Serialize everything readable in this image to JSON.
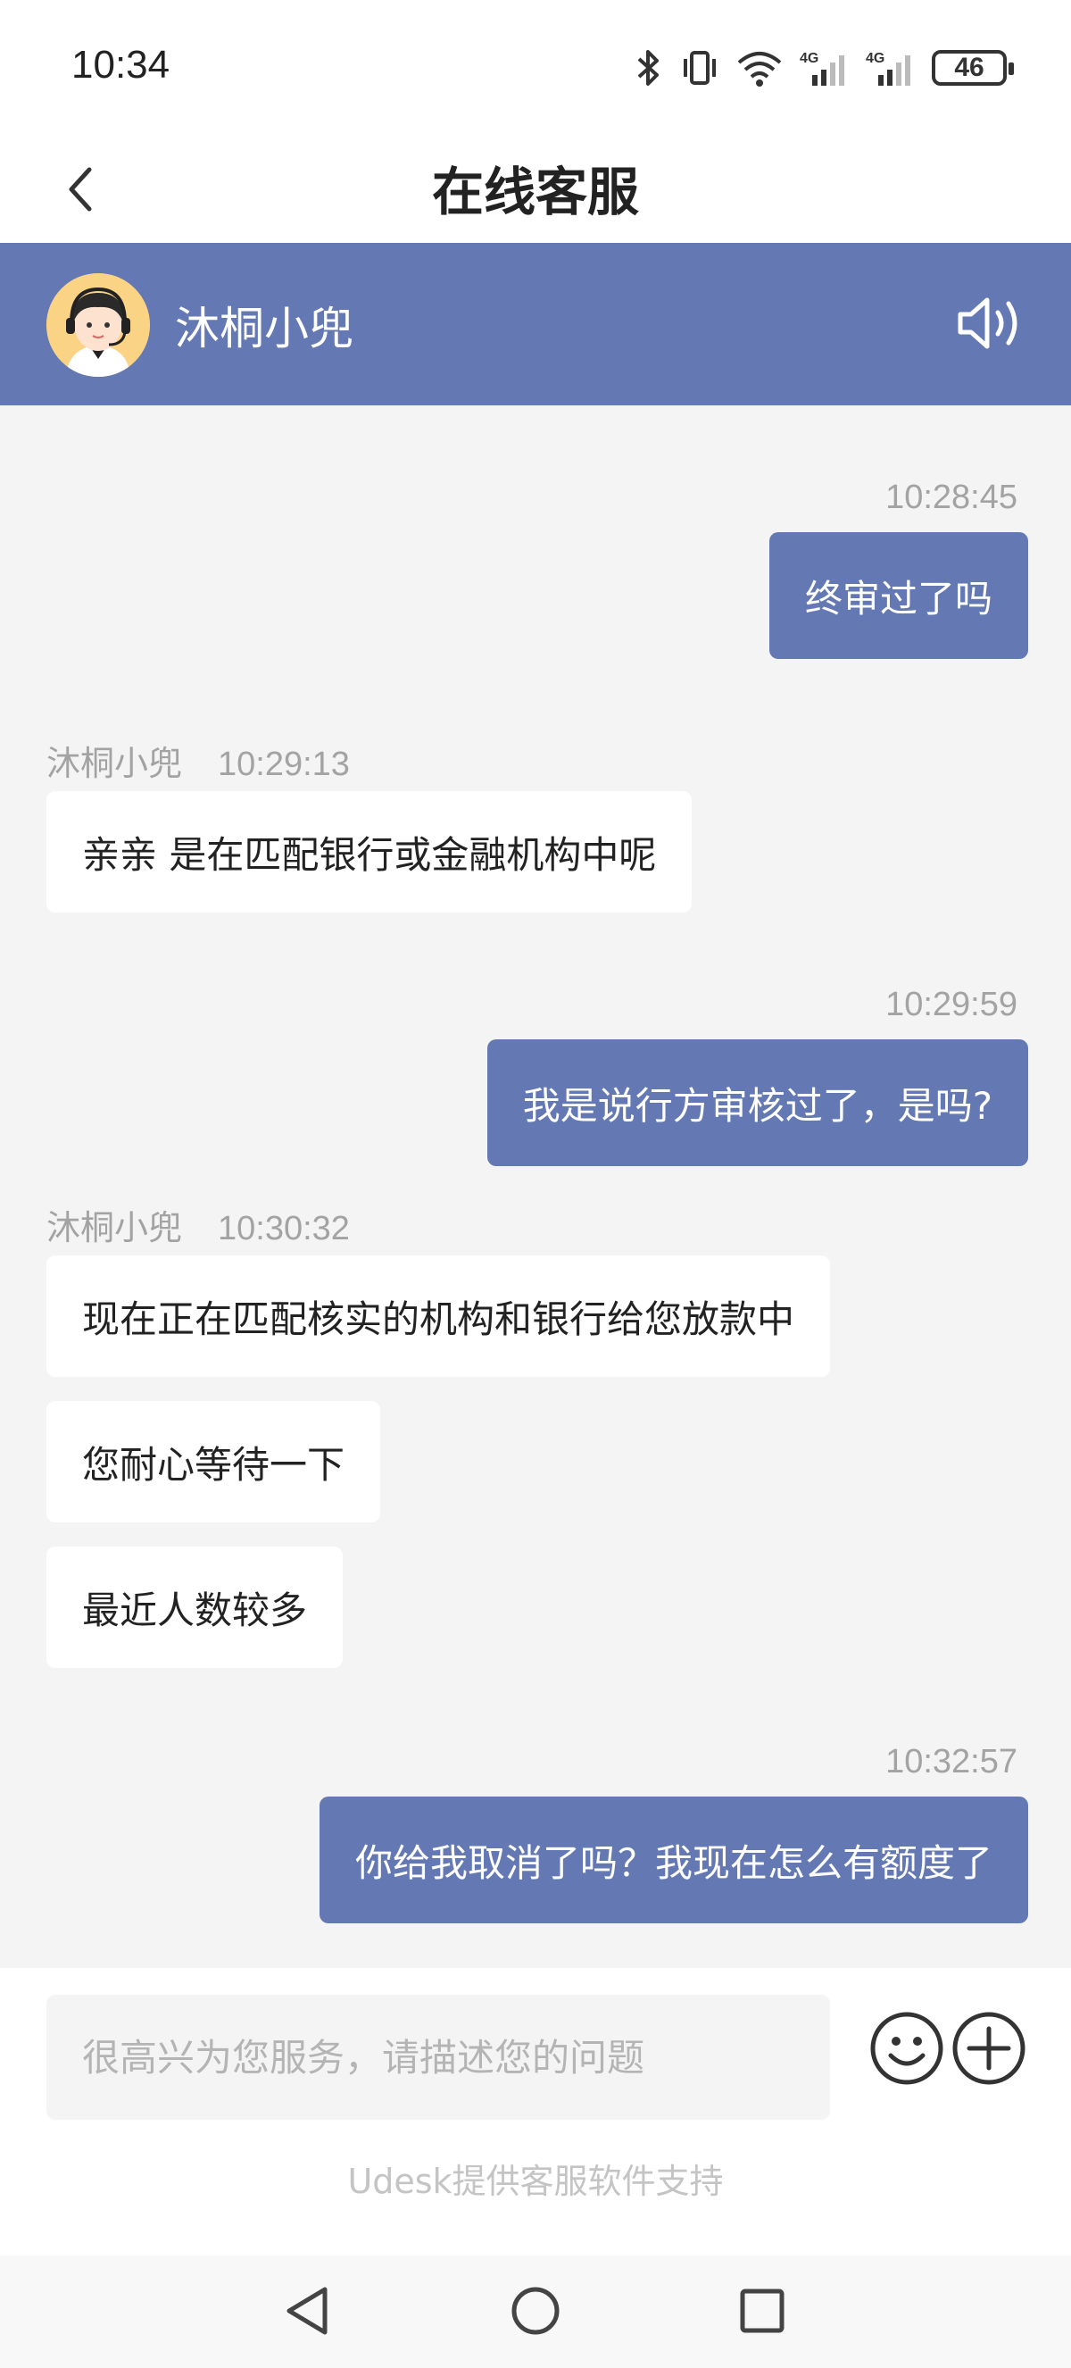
{
  "status_bar": {
    "time": "10:34",
    "battery": "46",
    "icons": [
      "bluetooth-icon",
      "vibrate-icon",
      "wifi-icon",
      "signal-4g-icon",
      "signal-4g-icon",
      "battery-icon"
    ],
    "network_labels": [
      "4G",
      "4G"
    ]
  },
  "header": {
    "title": "在线客服"
  },
  "agent": {
    "name": "沐桐小兜",
    "header_color": "#6479b3"
  },
  "messages": [
    {
      "side": "out",
      "time": "10:28:45",
      "text": "终审过了吗"
    },
    {
      "side": "in",
      "sender": "沐桐小兜",
      "time": "10:29:13",
      "texts": [
        "亲亲 是在匹配银行或金融机构中呢"
      ]
    },
    {
      "side": "out",
      "time": "10:29:59",
      "text": "我是说行方审核过了，是吗?"
    },
    {
      "side": "in",
      "sender": "沐桐小兜",
      "time": "10:30:32",
      "texts": [
        "现在正在匹配核实的机构和银行给您放款中",
        "您耐心等待一下",
        "最近人数较多"
      ]
    },
    {
      "side": "out",
      "time": "10:32:57",
      "text": "你给我取消了吗？我现在怎么有额度了"
    }
  ],
  "input": {
    "placeholder": "很高兴为您服务，请描述您的问题",
    "value": ""
  },
  "footer": {
    "powered_by": "Udesk提供客服软件支持"
  },
  "nav": {
    "icons": [
      "back-triangle-icon",
      "home-circle-icon",
      "recents-square-icon"
    ]
  }
}
